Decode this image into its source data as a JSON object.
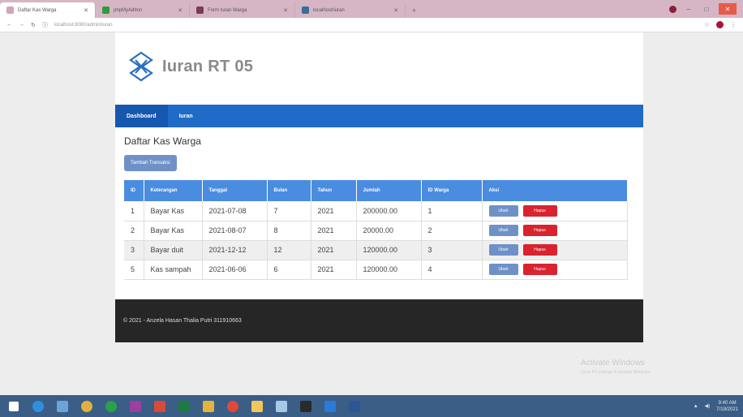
{
  "browser": {
    "tabs": [
      {
        "label": "Daftar Kas Warga",
        "favicon_color": "#d3a3b9",
        "active": true
      },
      {
        "label": "phpMyAdmin",
        "favicon_color": "#2c9c3c",
        "active": false
      },
      {
        "label": "Form Iuran Warga",
        "favicon_color": "#7b3b54",
        "active": false
      },
      {
        "label": "localhost/iuran",
        "favicon_color": "#3b6b9c",
        "active": false
      }
    ],
    "new_tab_icon": "plus-icon",
    "url": "localhost:8080/admin/iuran",
    "window_controls": [
      "minimize-icon",
      "maximize-icon",
      "close-icon"
    ]
  },
  "app": {
    "brand_title": "Iuran RT 05",
    "logo_color": "#2a6fc0",
    "nav": [
      {
        "label": "Dashboard",
        "active": true
      },
      {
        "label": "Iuran",
        "active": false
      }
    ],
    "section_title": "Daftar Kas Warga",
    "add_button": "Tambah Transaksi",
    "table": {
      "headers": [
        "ID",
        "Keterangan",
        "Tanggal",
        "Bulan",
        "Tahun",
        "Jumlah",
        "ID Warga",
        "Aksi"
      ],
      "rows": [
        [
          "1",
          "Bayar Kas",
          "2021-07-08",
          "7",
          "2021",
          "200000.00",
          "1"
        ],
        [
          "2",
          "Bayar Kas",
          "2021-08-07",
          "8",
          "2021",
          "20000.00",
          "2"
        ],
        [
          "3",
          "Bayar duit",
          "2021-12-12",
          "12",
          "2021",
          "120000.00",
          "3"
        ],
        [
          "5",
          "Kas sampah",
          "2021-06-06",
          "6",
          "2021",
          "120000.00",
          "4"
        ]
      ],
      "edit_label": "Ubah",
      "delete_label": "Hapus"
    },
    "footer": "© 2021 - Anzela Hasan Thalia Putri 311910663"
  },
  "watermark": {
    "title": "Activate Windows",
    "subtitle": "Go to PC settings to activate Windows."
  },
  "taskbar": {
    "apps": [
      {
        "icon": "windows-start-icon",
        "color": "#ffffff"
      },
      {
        "icon": "internet-explorer-icon",
        "color": "#2f8fe0"
      },
      {
        "icon": "store-icon",
        "color": "#6aa4d8"
      },
      {
        "icon": "people-icon",
        "color": "#e0b140"
      },
      {
        "icon": "media-icon",
        "color": "#2aa14a"
      },
      {
        "icon": "onenote-icon",
        "color": "#9b3fa0"
      },
      {
        "icon": "photos-icon",
        "color": "#d84a3a"
      },
      {
        "icon": "excel-icon",
        "color": "#1f7a3f"
      },
      {
        "icon": "folder-icon",
        "color": "#e2b43d"
      },
      {
        "icon": "chrome-icon",
        "color": "#e0483b"
      },
      {
        "icon": "file-explorer-icon",
        "color": "#f1c75b"
      },
      {
        "icon": "notepad-icon",
        "color": "#a8c8e8"
      },
      {
        "icon": "terminal-icon",
        "color": "#2a2a2a"
      },
      {
        "icon": "vscode-icon",
        "color": "#2a7bd6"
      },
      {
        "icon": "word-icon",
        "color": "#2b5797"
      }
    ],
    "clock_time": "9:40 AM",
    "clock_date": "7/19/2021"
  }
}
